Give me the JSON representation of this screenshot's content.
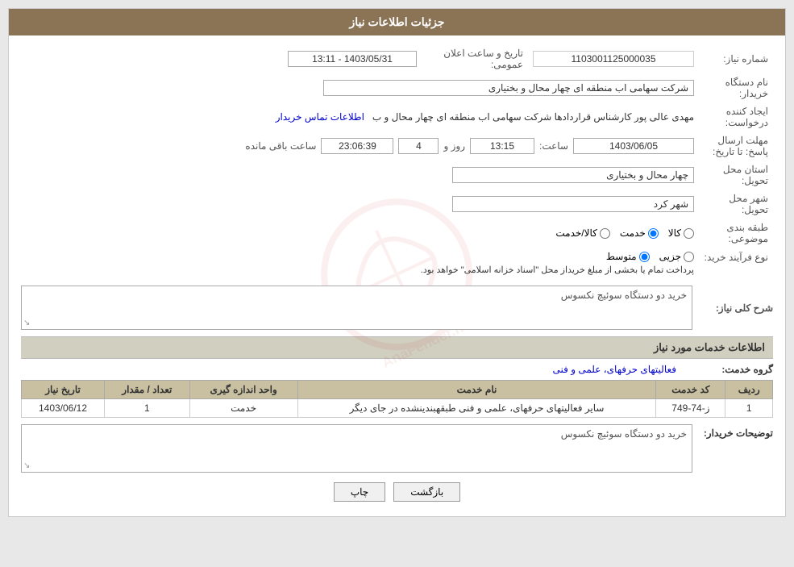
{
  "header": {
    "title": "جزئیات اطلاعات نیاز"
  },
  "fields": {
    "need_number_label": "شماره نیاز:",
    "need_number_value": "1103001125000035",
    "buyer_org_label": "نام دستگاه خریدار:",
    "buyer_org_value": "شرکت سهامی اب منطقه ای چهار محال و بختیاری",
    "requester_label": "ایجاد کننده درخواست:",
    "requester_value": "مهدی عالی پور کارشناس قراردادها شرکت سهامی اب منطقه ای چهار محال و ب",
    "requester_link": "اطلاعات تماس خریدار",
    "response_deadline_label": "مهلت ارسال پاسخ: تا تاریخ:",
    "response_date": "1403/06/05",
    "response_time_label": "ساعت:",
    "response_time": "13:15",
    "response_days_label": "روز و",
    "response_days": "4",
    "response_countdown_label": "ساعت باقی مانده",
    "response_countdown": "23:06:39",
    "delivery_province_label": "استان محل تحویل:",
    "delivery_province_value": "چهار محال و بختیاری",
    "delivery_city_label": "شهر محل تحویل:",
    "delivery_city_value": "شهر کرد",
    "announce_date_label": "تاریخ و ساعت اعلان عمومی:",
    "announce_date_value": "1403/05/31 - 13:11",
    "subject_label": "طبقه بندی موضوعی:",
    "subject_radio_options": [
      "کالا",
      "خدمت",
      "کالا/خدمت"
    ],
    "subject_selected": "خدمت",
    "purchase_type_label": "نوع فرآیند خرید:",
    "purchase_type_options": [
      "جزیی",
      "متوسط"
    ],
    "purchase_type_selected": "متوسط",
    "purchase_type_note": "پرداخت تمام یا بخشی از مبلغ خریداز محل \"اسناد خزانه اسلامی\" خواهد بود.",
    "general_desc_label": "شرح کلی نیاز:",
    "general_desc_value": "خرید دو دستگاه سوئیچ نکسوس",
    "services_section_label": "اطلاعات خدمات مورد نیاز",
    "group_service_label": "گروه خدمت:",
    "group_service_value": "فعالیتهای حرفهای، علمی و فنی",
    "table_headers": [
      "ردیف",
      "کد خدمت",
      "نام خدمت",
      "واحد اندازه گیری",
      "تعداد / مقدار",
      "تاریخ نیاز"
    ],
    "table_rows": [
      {
        "row_num": "1",
        "service_code": "ز-74-749",
        "service_name": "سایر فعالیتهای حرفهای، علمی و فنی طبقهبندینشده در جای دیگر",
        "unit": "خدمت",
        "quantity": "1",
        "need_date": "1403/06/12"
      }
    ],
    "buyer_notes_label": "توضیحات خریدار:",
    "buyer_notes_value": "خرید دو دستگاه سوئیچ نکسوس"
  },
  "buttons": {
    "print_label": "چاپ",
    "back_label": "بازگشت"
  }
}
